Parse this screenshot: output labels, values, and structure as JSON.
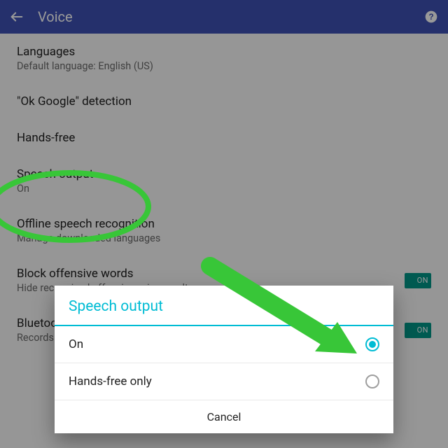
{
  "appbar": {
    "title": "Voice"
  },
  "settings": {
    "languages_label": "Languages",
    "languages_sub": "Default language: English (US)",
    "okgoogle_label": "\"Ok Google\" detection",
    "handsfree_label": "Hands-free",
    "speech_output_label": "Speech output",
    "speech_output_sub": "On",
    "offline_label": "Offline speech recognition",
    "offline_sub": "Manage downloaded languages",
    "block_label": "Block offensive words",
    "block_sub": "Hide recognized offensive voice results",
    "bluetooth_label": "Bluetooth headset",
    "bluetooth_sub": "Records audio through Bluetooth headset if available",
    "toggle_on": "ON"
  },
  "dialog": {
    "title": "Speech output",
    "option_on": "On",
    "option_hf": "Hands-free only",
    "cancel": "Cancel"
  },
  "annotation": {
    "ellipse_color": "#38c638",
    "arrow_color": "#38c638"
  }
}
